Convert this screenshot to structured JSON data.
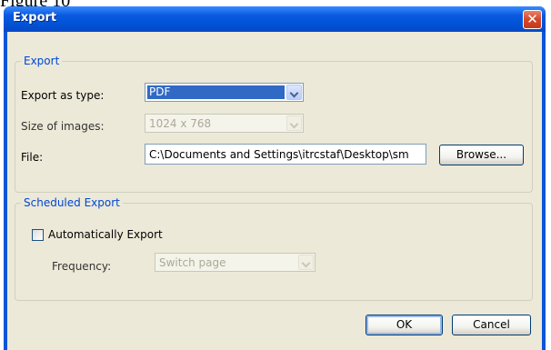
{
  "page_caption": "Figure 10",
  "window": {
    "title": "Export",
    "close_glyph": "✕"
  },
  "export_group": {
    "label": "Export",
    "type_label": "Export as type:",
    "type_value": "PDF",
    "size_label": "Size of images:",
    "size_value": "1024 x 768",
    "file_label": "File:",
    "file_value": "C:\\Documents and Settings\\itrcstaf\\Desktop\\sm",
    "browse_label": "Browse..."
  },
  "scheduled_group": {
    "label": "Scheduled Export",
    "auto_label": "Automatically Export",
    "auto_checked": false,
    "frequency_label": "Frequency:",
    "frequency_value": "Switch page"
  },
  "buttons": {
    "ok": "OK",
    "cancel": "Cancel"
  },
  "colors": {
    "titlebar": "#0a5ae0",
    "dialog_bg": "#ece9d8",
    "group_label": "#0046d5",
    "selection": "#316ac5",
    "close_button": "#d3482b"
  }
}
